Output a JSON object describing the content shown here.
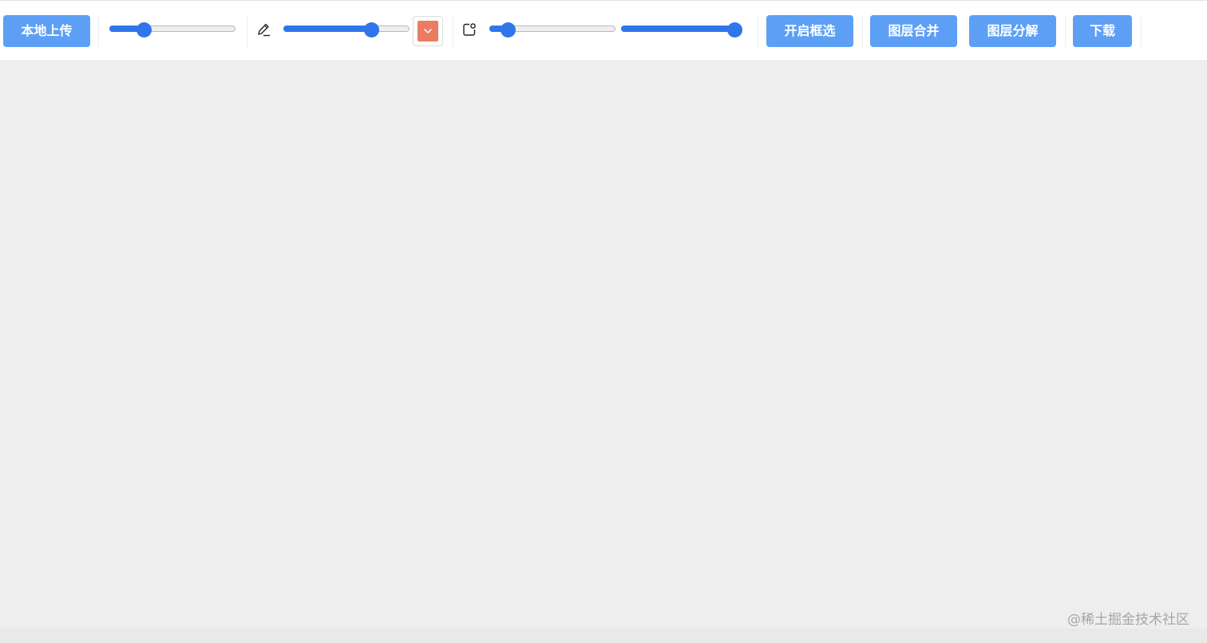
{
  "toolbar": {
    "upload_label": "本地上传",
    "box_select_label": "开启框选",
    "merge_layers_label": "图层合并",
    "split_layers_label": "图层分解",
    "download_label": "下载",
    "slider_1_value": 0.24,
    "brush_size_value": 0.72,
    "slider_3_value": 0.1,
    "slider_4_value": 1.0,
    "brush_color": "#e97c63",
    "icons": {
      "brush": "pencil-icon",
      "shape": "rounded-square-icon",
      "swatch_chevron": "chevron-down-icon"
    }
  },
  "watermark": "@稀土掘金技术社区",
  "colors": {
    "accent": "#2f76ea",
    "button": "#5d9ff5",
    "canvas": "#eeeeee"
  }
}
